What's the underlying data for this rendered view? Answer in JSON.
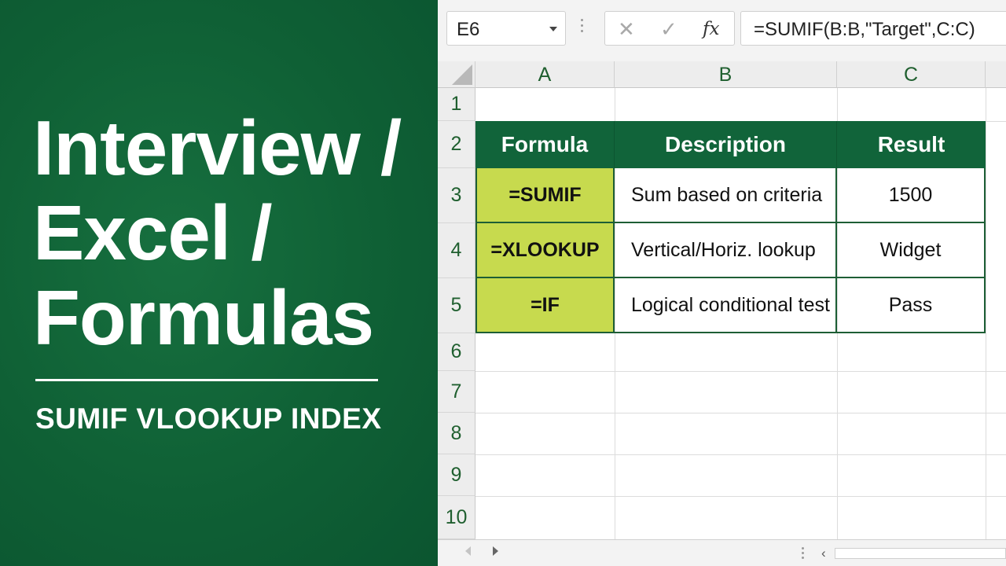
{
  "banner": {
    "title_lines": [
      "Interview /",
      "Excel /",
      "Formulas"
    ],
    "subtitle": "SUMIF VLOOKUP INDEX"
  },
  "formula_bar": {
    "name_box": "E6",
    "cancel_icon": "✕",
    "enter_icon": "✓",
    "fx_label": "fx",
    "formula": "=SUMIF(B:B,\"Target\",C:C)"
  },
  "columns": [
    "A",
    "B",
    "C"
  ],
  "rows": [
    "1",
    "2",
    "3",
    "4",
    "5",
    "6",
    "7",
    "8",
    "9",
    "10"
  ],
  "table": {
    "headers": [
      "Formula",
      "Description",
      "Result"
    ],
    "rows": [
      [
        "=SUMIF",
        "Sum based on criteria",
        "1500"
      ],
      [
        "=XLOOKUP",
        "Vertical/Horiz. lookup",
        "Widget"
      ],
      [
        "=IF",
        "Logical conditional test",
        "Pass"
      ]
    ]
  },
  "colors": {
    "banner_green": "#0f6035",
    "header_green": "#11643a",
    "formula_cell": "#c7da4e"
  }
}
